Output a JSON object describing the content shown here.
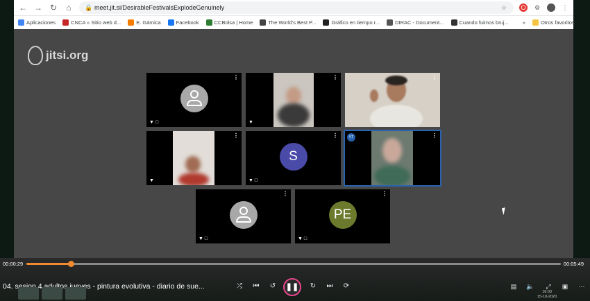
{
  "browser": {
    "url": "meet.jit.si/DesirableFestivalsExplodeGenuinely",
    "bookmarks": [
      {
        "label": "Aplicaciones",
        "color": "#4285f4"
      },
      {
        "label": "CNCA » Sitio web d...",
        "color": "#c62828"
      },
      {
        "label": "E. Gárnica",
        "color": "#f57c00"
      },
      {
        "label": "Facebook",
        "color": "#1877f2"
      },
      {
        "label": "CCBolsa | Home",
        "color": "#2e7d32"
      },
      {
        "label": "The World's Best P...",
        "color": "#444444"
      },
      {
        "label": "Gráfico en tiempo r...",
        "color": "#222222"
      },
      {
        "label": "DIRAC - Document...",
        "color": "#555555"
      },
      {
        "label": "Cuando fuimos bruj...",
        "color": "#333333"
      }
    ],
    "bookmarks_more": "»",
    "other_bookmarks": "Otros favoritos"
  },
  "meeting": {
    "logo_text": "jitsi.org",
    "tiles": [
      {
        "kind": "generic"
      },
      {
        "kind": "video"
      },
      {
        "kind": "video"
      },
      {
        "kind": "video"
      },
      {
        "kind": "letter",
        "initials": "S",
        "color": "#4a4aa8"
      },
      {
        "kind": "video",
        "active": true
      },
      {
        "kind": "generic"
      },
      {
        "kind": "letter",
        "initials": "PE",
        "color": "#6b7a2c"
      }
    ]
  },
  "player": {
    "current_time": "00:00:29",
    "total_time": "00:05:49",
    "progress": 0.083,
    "title": "04. sesion 4 adultos jueves  - pintura evolutiva - diario de sue...",
    "clock_time": "16:03",
    "clock_date": "15-10-2020"
  }
}
